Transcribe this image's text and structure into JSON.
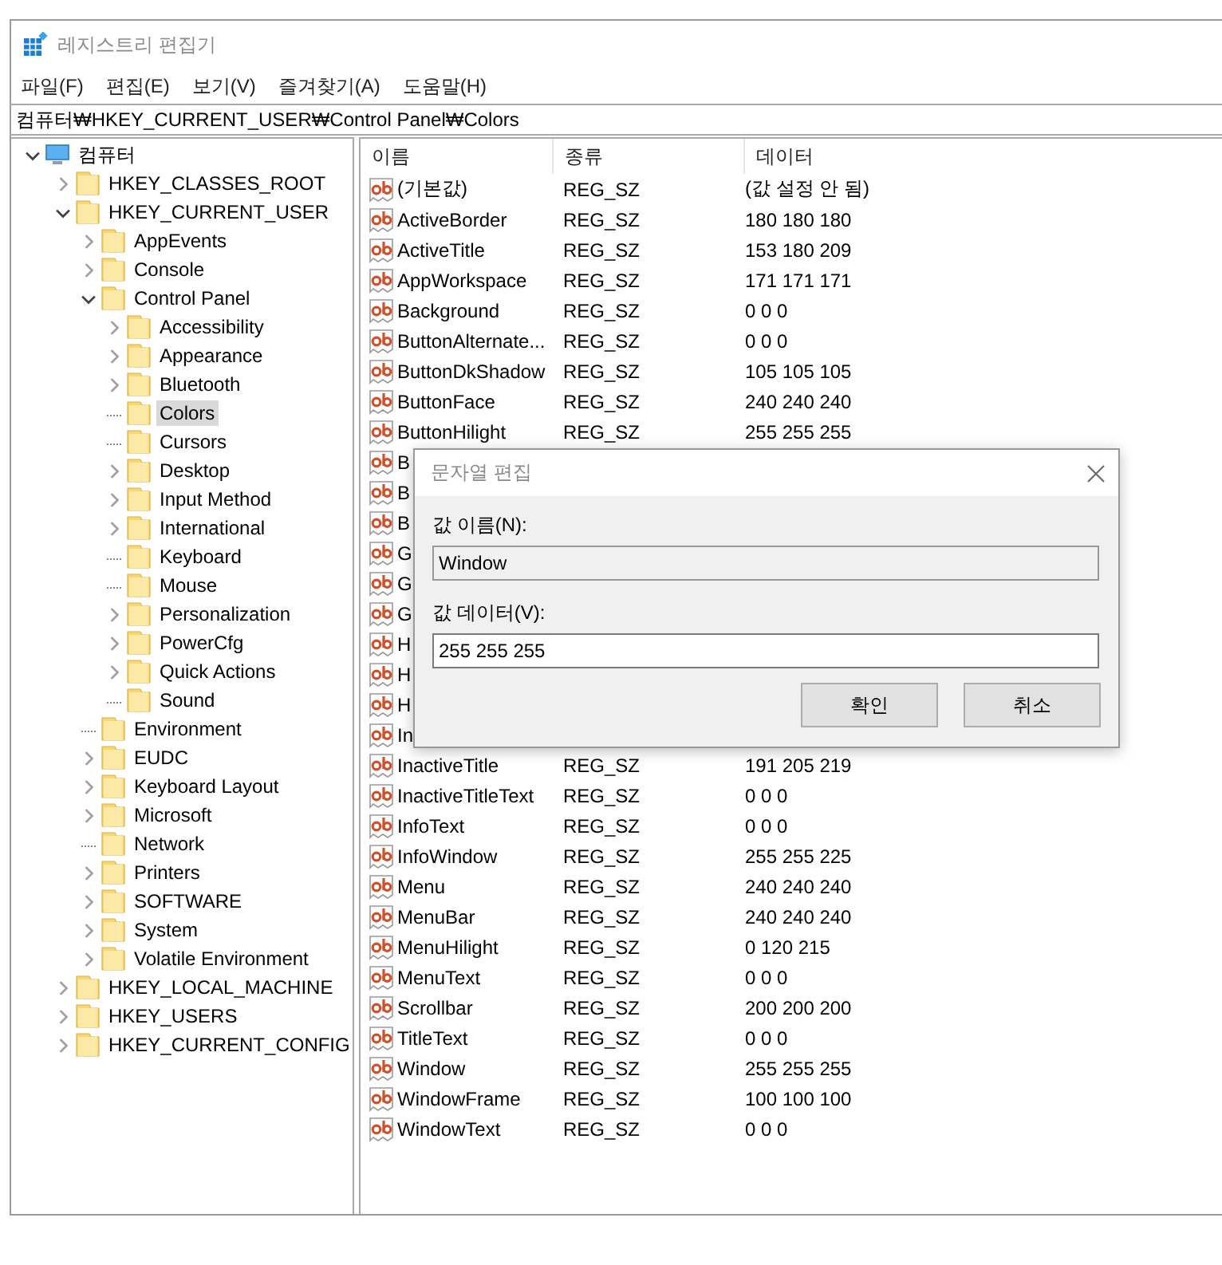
{
  "window": {
    "title": "레지스트리 편집기"
  },
  "menu": [
    "파일(F)",
    "편집(E)",
    "보기(V)",
    "즐겨찾기(A)",
    "도움말(H)"
  ],
  "address": "컴퓨터₩HKEY_CURRENT_USER₩Control Panel₩Colors",
  "tree": {
    "label": "컴퓨터",
    "expanded": true,
    "selected": false,
    "children": [
      {
        "label": "HKEY_CLASSES_ROOT",
        "expandable": true,
        "expanded": false,
        "selected": false
      },
      {
        "label": "HKEY_CURRENT_USER",
        "expandable": true,
        "expanded": true,
        "selected": false,
        "children": [
          {
            "label": "AppEvents",
            "expandable": true,
            "expanded": false,
            "selected": false
          },
          {
            "label": "Console",
            "expandable": true,
            "expanded": false,
            "selected": false
          },
          {
            "label": "Control Panel",
            "expandable": true,
            "expanded": true,
            "selected": false,
            "children": [
              {
                "label": "Accessibility",
                "expandable": true,
                "expanded": false,
                "selected": false
              },
              {
                "label": "Appearance",
                "expandable": true,
                "expanded": false,
                "selected": false
              },
              {
                "label": "Bluetooth",
                "expandable": true,
                "expanded": false,
                "selected": false
              },
              {
                "label": "Colors",
                "expandable": false,
                "expanded": false,
                "selected": true
              },
              {
                "label": "Cursors",
                "expandable": false,
                "expanded": false,
                "selected": false
              },
              {
                "label": "Desktop",
                "expandable": true,
                "expanded": false,
                "selected": false
              },
              {
                "label": "Input Method",
                "expandable": true,
                "expanded": false,
                "selected": false
              },
              {
                "label": "International",
                "expandable": true,
                "expanded": false,
                "selected": false
              },
              {
                "label": "Keyboard",
                "expandable": false,
                "expanded": false,
                "selected": false
              },
              {
                "label": "Mouse",
                "expandable": false,
                "expanded": false,
                "selected": false
              },
              {
                "label": "Personalization",
                "expandable": true,
                "expanded": false,
                "selected": false
              },
              {
                "label": "PowerCfg",
                "expandable": true,
                "expanded": false,
                "selected": false
              },
              {
                "label": "Quick Actions",
                "expandable": true,
                "expanded": false,
                "selected": false
              },
              {
                "label": "Sound",
                "expandable": false,
                "expanded": false,
                "selected": false
              }
            ]
          },
          {
            "label": "Environment",
            "expandable": false,
            "expanded": false,
            "selected": false
          },
          {
            "label": "EUDC",
            "expandable": true,
            "expanded": false,
            "selected": false
          },
          {
            "label": "Keyboard Layout",
            "expandable": true,
            "expanded": false,
            "selected": false
          },
          {
            "label": "Microsoft",
            "expandable": true,
            "expanded": false,
            "selected": false
          },
          {
            "label": "Network",
            "expandable": false,
            "expanded": false,
            "selected": false
          },
          {
            "label": "Printers",
            "expandable": true,
            "expanded": false,
            "selected": false
          },
          {
            "label": "SOFTWARE",
            "expandable": true,
            "expanded": false,
            "selected": false
          },
          {
            "label": "System",
            "expandable": true,
            "expanded": false,
            "selected": false
          },
          {
            "label": "Volatile Environment",
            "expandable": true,
            "expanded": false,
            "selected": false
          }
        ]
      },
      {
        "label": "HKEY_LOCAL_MACHINE",
        "expandable": true,
        "expanded": false,
        "selected": false
      },
      {
        "label": "HKEY_USERS",
        "expandable": true,
        "expanded": false,
        "selected": false
      },
      {
        "label": "HKEY_CURRENT_CONFIG",
        "expandable": true,
        "expanded": false,
        "selected": false
      }
    ]
  },
  "table": {
    "columns": [
      "이름",
      "종류",
      "데이터"
    ],
    "rows": [
      {
        "name": "(기본값)",
        "type": "REG_SZ",
        "data": "(값 설정 안 됨)"
      },
      {
        "name": "ActiveBorder",
        "type": "REG_SZ",
        "data": "180 180 180"
      },
      {
        "name": "ActiveTitle",
        "type": "REG_SZ",
        "data": "153 180 209"
      },
      {
        "name": "AppWorkspace",
        "type": "REG_SZ",
        "data": "171 171 171"
      },
      {
        "name": "Background",
        "type": "REG_SZ",
        "data": "0 0 0"
      },
      {
        "name": "ButtonAlternate...",
        "type": "REG_SZ",
        "data": "0 0 0"
      },
      {
        "name": "ButtonDkShadow",
        "type": "REG_SZ",
        "data": "105 105 105"
      },
      {
        "name": "ButtonFace",
        "type": "REG_SZ",
        "data": "240 240 240"
      },
      {
        "name": "ButtonHilight",
        "type": "REG_SZ",
        "data": "255 255 255"
      },
      {
        "name": "B"
      },
      {
        "name": "B"
      },
      {
        "name": "B"
      },
      {
        "name": "G"
      },
      {
        "name": "G"
      },
      {
        "name": "G"
      },
      {
        "name": "H"
      },
      {
        "name": "H"
      },
      {
        "name": "H"
      },
      {
        "name": "In"
      },
      {
        "name": "InactiveTitle",
        "type": "REG_SZ",
        "data": "191 205 219"
      },
      {
        "name": "InactiveTitleText",
        "type": "REG_SZ",
        "data": "0 0 0"
      },
      {
        "name": "InfoText",
        "type": "REG_SZ",
        "data": "0 0 0"
      },
      {
        "name": "InfoWindow",
        "type": "REG_SZ",
        "data": "255 255 225"
      },
      {
        "name": "Menu",
        "type": "REG_SZ",
        "data": "240 240 240"
      },
      {
        "name": "MenuBar",
        "type": "REG_SZ",
        "data": "240 240 240"
      },
      {
        "name": "MenuHilight",
        "type": "REG_SZ",
        "data": "0 120 215"
      },
      {
        "name": "MenuText",
        "type": "REG_SZ",
        "data": "0 0 0"
      },
      {
        "name": "Scrollbar",
        "type": "REG_SZ",
        "data": "200 200 200"
      },
      {
        "name": "TitleText",
        "type": "REG_SZ",
        "data": "0 0 0"
      },
      {
        "name": "Window",
        "type": "REG_SZ",
        "data": "255 255 255"
      },
      {
        "name": "WindowFrame",
        "type": "REG_SZ",
        "data": "100 100 100"
      },
      {
        "name": "WindowText",
        "type": "REG_SZ",
        "data": "0 0 0"
      }
    ]
  },
  "dialog": {
    "title": "문자열 편집",
    "name_label": "값 이름(N):",
    "name_value": "Window",
    "data_label": "값 데이터(V):",
    "data_value": "255 255 255",
    "buttons": [
      "확인",
      "취소"
    ]
  }
}
